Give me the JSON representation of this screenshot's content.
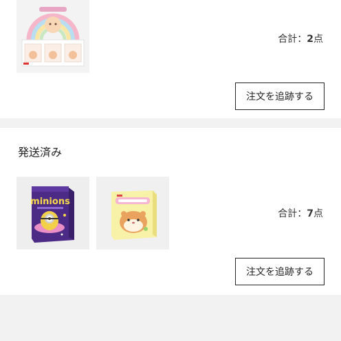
{
  "orders": [
    {
      "status": "",
      "total_label": "合計：",
      "total_count": "2",
      "total_unit": "点",
      "track_button": "注文を追跡する",
      "products": [
        {
          "name": "pastel-box-set-product-image"
        }
      ]
    },
    {
      "status": "発送済み",
      "total_label": "合計：",
      "total_count": "7",
      "total_unit": "点",
      "track_button": "注文を追跡する",
      "products": [
        {
          "name": "minions-blind-box-product-image",
          "box_text": "minions"
        },
        {
          "name": "hamster-blind-box-product-image"
        }
      ]
    }
  ]
}
